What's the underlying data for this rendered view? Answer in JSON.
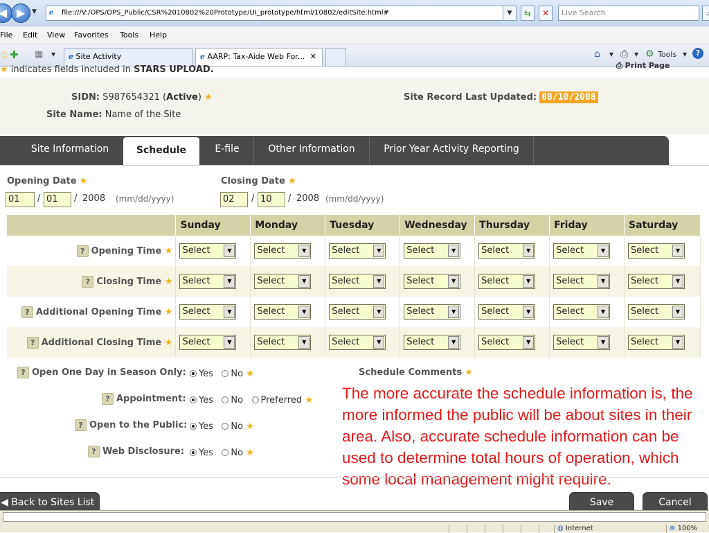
{
  "browser": {
    "url": "file:///V:/OPS/OPS_Public/CSR%2010802%20Prototype/UI_prototype/html/10802/editSite.html#",
    "search_placeholder": "Live Search",
    "menu": [
      "File",
      "Edit",
      "View",
      "Favorites",
      "Tools",
      "Help"
    ],
    "tabs": [
      "Site Activity",
      "AARP: Tax-Aide Web For..."
    ],
    "toolbar": {
      "tools_label": "Tools"
    }
  },
  "page": {
    "stars_note_prefix": "indicates fields included in",
    "stars_note_bold": "STARS UPLOAD.",
    "print_label": "Print Page",
    "sidn_label": "SIDN:",
    "sidn_value": "S987654321",
    "sidn_status": "Active",
    "site_name_label": "Site Name:",
    "site_name_value": "Name of the Site",
    "updated_label": "Site Record Last Updated:",
    "updated_value": "08/10/2008"
  },
  "tabs": [
    "Site Information",
    "Schedule",
    "E-file",
    "Other Information",
    "Prior Year Activity Reporting"
  ],
  "dates": {
    "opening_label": "Opening Date",
    "opening_mm": "01",
    "opening_dd": "01",
    "opening_year": "2008",
    "closing_label": "Closing Date",
    "closing_mm": "02",
    "closing_dd": "10",
    "closing_year": "2008",
    "format_hint": "(mm/dd/yyyy)"
  },
  "schedule": {
    "days": [
      "Sunday",
      "Monday",
      "Tuesday",
      "Wednesday",
      "Thursday",
      "Friday",
      "Saturday"
    ],
    "rows": [
      "Opening Time",
      "Closing Time",
      "Additional Opening Time",
      "Additional Closing Time"
    ],
    "select_value": "Select"
  },
  "questions": {
    "one_day": "Open One Day in Season Only:",
    "appointment": "Appointment:",
    "public": "Open to the Public:",
    "web": "Web Disclosure:",
    "yes": "Yes",
    "no": "No",
    "preferred": "Preferred",
    "comments_label": "Schedule Comments"
  },
  "annotation": "The more accurate the schedule information is, the more informed the public will be about sites in their area.  Also, accurate schedule information can be used to determine total hours of operation, which some local management might require.",
  "buttons": {
    "back": "Back to Sites List",
    "save": "Save",
    "cancel": "Cancel"
  },
  "status": {
    "zone": "Internet",
    "zoom": "100%"
  },
  "colors": {
    "accent_orange": "#f5a623",
    "star": "#f2b21a",
    "annotation_red": "#e01b1b",
    "tab_dark": "#4a4a4a"
  }
}
